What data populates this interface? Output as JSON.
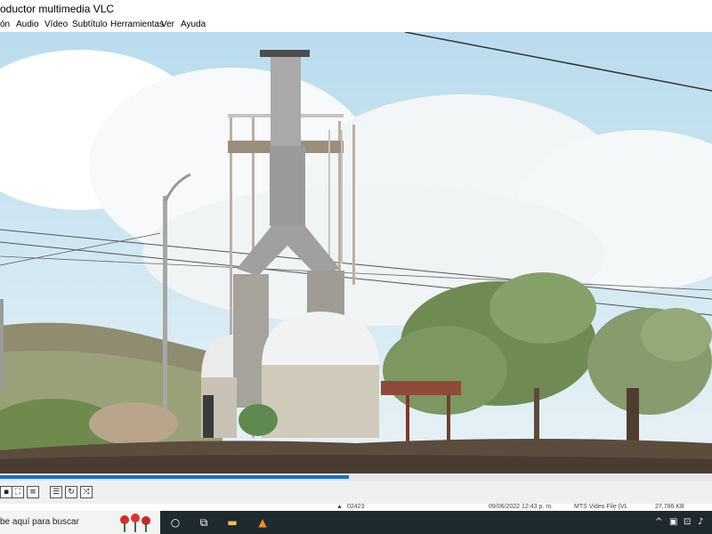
{
  "window": {
    "title": "oductor multimedia VLC"
  },
  "menu": [
    "ón",
    "Audio",
    "Vídeo",
    "Subtítulo",
    "Herramientas",
    "Ver",
    "Ayuda"
  ],
  "playback": {
    "progress": 0.49
  },
  "file_strip": {
    "name": "02423",
    "date": "09/06/2022 12:43 p. m.",
    "type": "MTS Video File (VL",
    "size": "27,786 KB"
  },
  "taskbar": {
    "search_placeholder": "be aquí para buscar"
  },
  "colors": {
    "accent": "#1b6fd1",
    "taskbar": "#1f2a30"
  }
}
